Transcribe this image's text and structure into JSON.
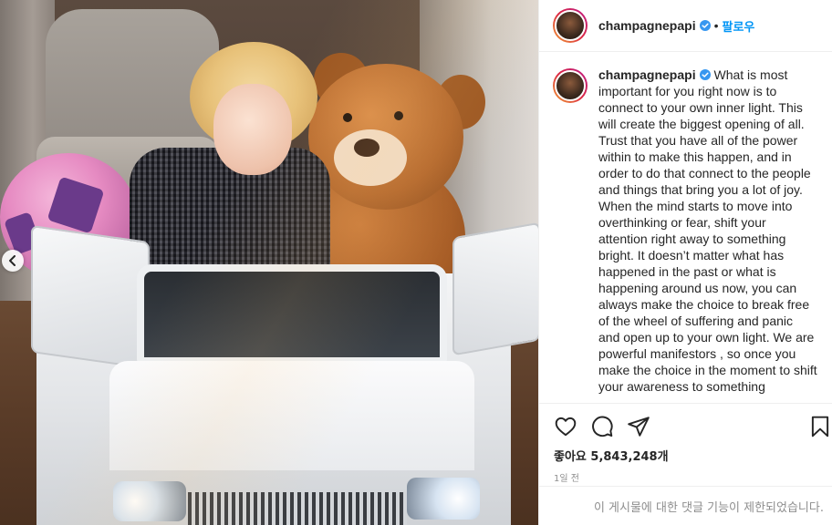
{
  "post": {
    "image_alt": "photo",
    "carousel_prev_icon": "chevron-left-icon"
  },
  "header": {
    "username": "champagnepapi",
    "verified_icon": "verified-badge-icon",
    "separator": "•",
    "follow_label": "팔로우"
  },
  "caption": {
    "username": "champagnepapi",
    "text": "What is most important for you right now is to connect to your own inner light. This will create the biggest opening of all. Trust that you have all of the power within to make this happen, and in order to do that connect to the people and things that bring you a lot of joy. When the mind starts to move into overthinking or fear, shift your attention right away to something bright. It doesn’t matter what has happened in the past or what is happening around us now, you can always make the choice to break free of the wheel of suffering and panic and open up to your own light. We are powerful manifestors , so once you make the choice in the moment to shift your awareness to something"
  },
  "actions": {
    "icons": [
      "heart-icon",
      "comment-icon",
      "share-icon",
      "bookmark-icon"
    ],
    "likes_label": "좋아요 5,843,248개",
    "timestamp": "1일 전",
    "comments_disabled": "이 게시물에 대한 댓글 기능이 제한되었습니다."
  },
  "colors": {
    "link_blue": "#0095f6",
    "text_primary": "#262626",
    "text_secondary": "#8e8e8e",
    "verified_blue": "#3897f0"
  }
}
